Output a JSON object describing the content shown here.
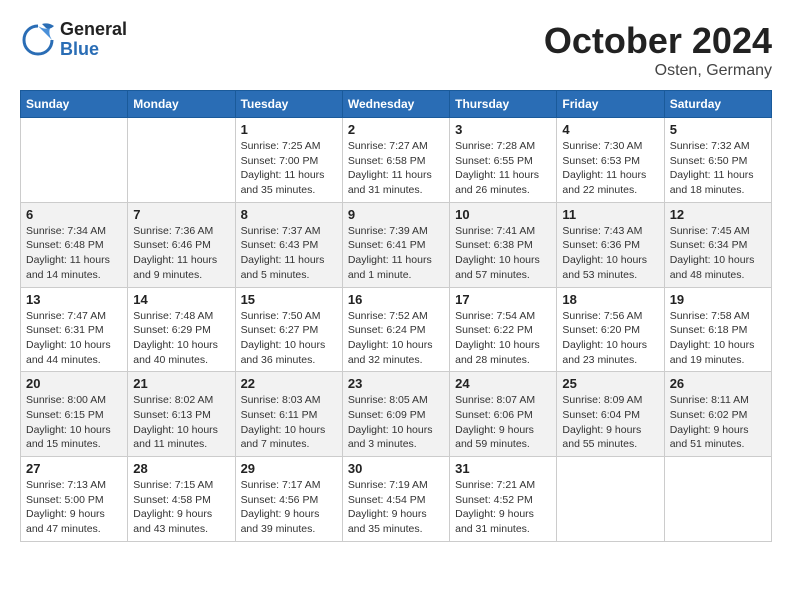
{
  "header": {
    "logo": {
      "general": "General",
      "blue": "Blue"
    },
    "month": "October 2024",
    "location": "Osten, Germany"
  },
  "weekdays": [
    "Sunday",
    "Monday",
    "Tuesday",
    "Wednesday",
    "Thursday",
    "Friday",
    "Saturday"
  ],
  "weeks": [
    [
      {
        "day": "",
        "info": ""
      },
      {
        "day": "",
        "info": ""
      },
      {
        "day": "1",
        "info": "Sunrise: 7:25 AM\nSunset: 7:00 PM\nDaylight: 11 hours\nand 35 minutes."
      },
      {
        "day": "2",
        "info": "Sunrise: 7:27 AM\nSunset: 6:58 PM\nDaylight: 11 hours\nand 31 minutes."
      },
      {
        "day": "3",
        "info": "Sunrise: 7:28 AM\nSunset: 6:55 PM\nDaylight: 11 hours\nand 26 minutes."
      },
      {
        "day": "4",
        "info": "Sunrise: 7:30 AM\nSunset: 6:53 PM\nDaylight: 11 hours\nand 22 minutes."
      },
      {
        "day": "5",
        "info": "Sunrise: 7:32 AM\nSunset: 6:50 PM\nDaylight: 11 hours\nand 18 minutes."
      }
    ],
    [
      {
        "day": "6",
        "info": "Sunrise: 7:34 AM\nSunset: 6:48 PM\nDaylight: 11 hours\nand 14 minutes."
      },
      {
        "day": "7",
        "info": "Sunrise: 7:36 AM\nSunset: 6:46 PM\nDaylight: 11 hours\nand 9 minutes."
      },
      {
        "day": "8",
        "info": "Sunrise: 7:37 AM\nSunset: 6:43 PM\nDaylight: 11 hours\nand 5 minutes."
      },
      {
        "day": "9",
        "info": "Sunrise: 7:39 AM\nSunset: 6:41 PM\nDaylight: 11 hours\nand 1 minute."
      },
      {
        "day": "10",
        "info": "Sunrise: 7:41 AM\nSunset: 6:38 PM\nDaylight: 10 hours\nand 57 minutes."
      },
      {
        "day": "11",
        "info": "Sunrise: 7:43 AM\nSunset: 6:36 PM\nDaylight: 10 hours\nand 53 minutes."
      },
      {
        "day": "12",
        "info": "Sunrise: 7:45 AM\nSunset: 6:34 PM\nDaylight: 10 hours\nand 48 minutes."
      }
    ],
    [
      {
        "day": "13",
        "info": "Sunrise: 7:47 AM\nSunset: 6:31 PM\nDaylight: 10 hours\nand 44 minutes."
      },
      {
        "day": "14",
        "info": "Sunrise: 7:48 AM\nSunset: 6:29 PM\nDaylight: 10 hours\nand 40 minutes."
      },
      {
        "day": "15",
        "info": "Sunrise: 7:50 AM\nSunset: 6:27 PM\nDaylight: 10 hours\nand 36 minutes."
      },
      {
        "day": "16",
        "info": "Sunrise: 7:52 AM\nSunset: 6:24 PM\nDaylight: 10 hours\nand 32 minutes."
      },
      {
        "day": "17",
        "info": "Sunrise: 7:54 AM\nSunset: 6:22 PM\nDaylight: 10 hours\nand 28 minutes."
      },
      {
        "day": "18",
        "info": "Sunrise: 7:56 AM\nSunset: 6:20 PM\nDaylight: 10 hours\nand 23 minutes."
      },
      {
        "day": "19",
        "info": "Sunrise: 7:58 AM\nSunset: 6:18 PM\nDaylight: 10 hours\nand 19 minutes."
      }
    ],
    [
      {
        "day": "20",
        "info": "Sunrise: 8:00 AM\nSunset: 6:15 PM\nDaylight: 10 hours\nand 15 minutes."
      },
      {
        "day": "21",
        "info": "Sunrise: 8:02 AM\nSunset: 6:13 PM\nDaylight: 10 hours\nand 11 minutes."
      },
      {
        "day": "22",
        "info": "Sunrise: 8:03 AM\nSunset: 6:11 PM\nDaylight: 10 hours\nand 7 minutes."
      },
      {
        "day": "23",
        "info": "Sunrise: 8:05 AM\nSunset: 6:09 PM\nDaylight: 10 hours\nand 3 minutes."
      },
      {
        "day": "24",
        "info": "Sunrise: 8:07 AM\nSunset: 6:06 PM\nDaylight: 9 hours\nand 59 minutes."
      },
      {
        "day": "25",
        "info": "Sunrise: 8:09 AM\nSunset: 6:04 PM\nDaylight: 9 hours\nand 55 minutes."
      },
      {
        "day": "26",
        "info": "Sunrise: 8:11 AM\nSunset: 6:02 PM\nDaylight: 9 hours\nand 51 minutes."
      }
    ],
    [
      {
        "day": "27",
        "info": "Sunrise: 7:13 AM\nSunset: 5:00 PM\nDaylight: 9 hours\nand 47 minutes."
      },
      {
        "day": "28",
        "info": "Sunrise: 7:15 AM\nSunset: 4:58 PM\nDaylight: 9 hours\nand 43 minutes."
      },
      {
        "day": "29",
        "info": "Sunrise: 7:17 AM\nSunset: 4:56 PM\nDaylight: 9 hours\nand 39 minutes."
      },
      {
        "day": "30",
        "info": "Sunrise: 7:19 AM\nSunset: 4:54 PM\nDaylight: 9 hours\nand 35 minutes."
      },
      {
        "day": "31",
        "info": "Sunrise: 7:21 AM\nSunset: 4:52 PM\nDaylight: 9 hours\nand 31 minutes."
      },
      {
        "day": "",
        "info": ""
      },
      {
        "day": "",
        "info": ""
      }
    ]
  ]
}
